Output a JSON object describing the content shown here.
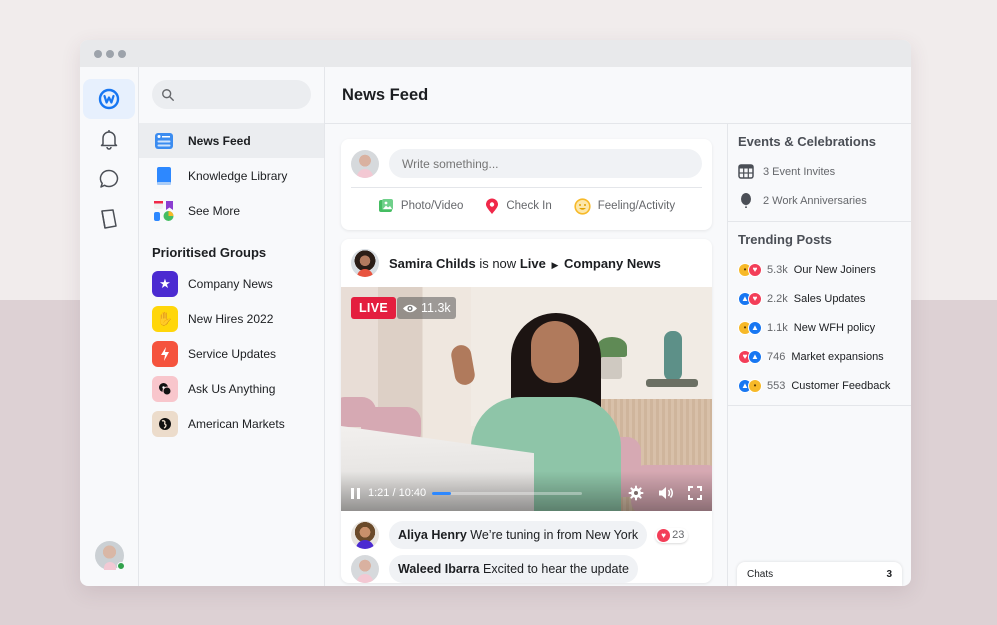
{
  "window": {
    "controls": [
      "close",
      "minimize",
      "maximize"
    ]
  },
  "rail": {
    "items": [
      {
        "name": "workplace-logo",
        "icon": "workplace-icon",
        "active": true
      },
      {
        "name": "notifications",
        "icon": "bell-icon",
        "active": false
      },
      {
        "name": "chats",
        "icon": "chat-bubble-icon",
        "active": false
      },
      {
        "name": "library",
        "icon": "book-icon",
        "active": false
      }
    ],
    "user_status": "online"
  },
  "nav": {
    "search_placeholder": "",
    "items": [
      {
        "label": "News Feed",
        "icon": "news-feed-icon",
        "active": true
      },
      {
        "label": "Knowledge Library",
        "icon": "knowledge-library-icon",
        "active": false
      },
      {
        "label": "See More",
        "icon": "see-more-icon",
        "active": false
      }
    ],
    "groups_title": "Prioritised Groups",
    "groups": [
      {
        "label": "Company News",
        "icon": "star-icon",
        "color": "#4b2bd1",
        "glyph": "★"
      },
      {
        "label": "New Hires 2022",
        "icon": "wave-hand-icon",
        "color": "#ffd60a",
        "glyph": "✋"
      },
      {
        "label": "Service Updates",
        "icon": "lightning-icon",
        "color": "#f5533d",
        "glyph": "⚡"
      },
      {
        "label": "Ask Us Anything",
        "icon": "speech-bubbles-icon",
        "color": "#f8c6cc",
        "glyph": "💬"
      },
      {
        "label": "American Markets",
        "icon": "globe-icon",
        "color": "#ecdccb",
        "glyph": "🌎"
      }
    ]
  },
  "header": {
    "title": "News Feed"
  },
  "composer": {
    "placeholder": "Write something...",
    "actions": [
      {
        "label": "Photo/Video",
        "icon": "photo-video-icon",
        "color": "#45bd62"
      },
      {
        "label": "Check In",
        "icon": "location-pin-icon",
        "color": "#f02849"
      },
      {
        "label": "Feeling/Activity",
        "icon": "smiley-icon",
        "color": "#f7b928"
      }
    ]
  },
  "post": {
    "author": "Samira Childs",
    "is_now": "is now",
    "status": "Live",
    "group": "Company News",
    "live_label": "LIVE",
    "viewers": "11.3k",
    "current_time": "1:21",
    "duration": "10:40",
    "time_separator": "/",
    "progress_percent": 12.7
  },
  "comments": [
    {
      "author": "Aliya Henry",
      "text": "We’re tuning in from New York",
      "reaction": "love",
      "reaction_count": "23"
    },
    {
      "author": "Waleed Ibarra",
      "text": "Excited to hear the update"
    }
  ],
  "events": {
    "title": "Events & Celebrations",
    "items": [
      {
        "label": "3 Event Invites",
        "icon": "calendar-icon"
      },
      {
        "label": "2 Work Anniversaries",
        "icon": "balloon-icon"
      }
    ]
  },
  "trending": {
    "title": "Trending Posts",
    "items": [
      {
        "reactions": [
          "wow",
          "love"
        ],
        "count": "5.3k",
        "label": "Our New Joiners"
      },
      {
        "reactions": [
          "like",
          "love"
        ],
        "count": "2.2k",
        "label": "Sales Updates"
      },
      {
        "reactions": [
          "wow",
          "like"
        ],
        "count": "1.1k",
        "label": "New WFH policy"
      },
      {
        "reactions": [
          "love",
          "like"
        ],
        "count": "746",
        "label": "Market expansions"
      },
      {
        "reactions": [
          "like",
          "wow"
        ],
        "count": "553",
        "label": "Customer Feedback"
      }
    ]
  },
  "chats": {
    "label": "Chats",
    "count": "3"
  },
  "colors": {
    "accent": "#1877f2",
    "live": "#e41e3f",
    "online": "#31a24c",
    "progress": "#2d88ff"
  }
}
